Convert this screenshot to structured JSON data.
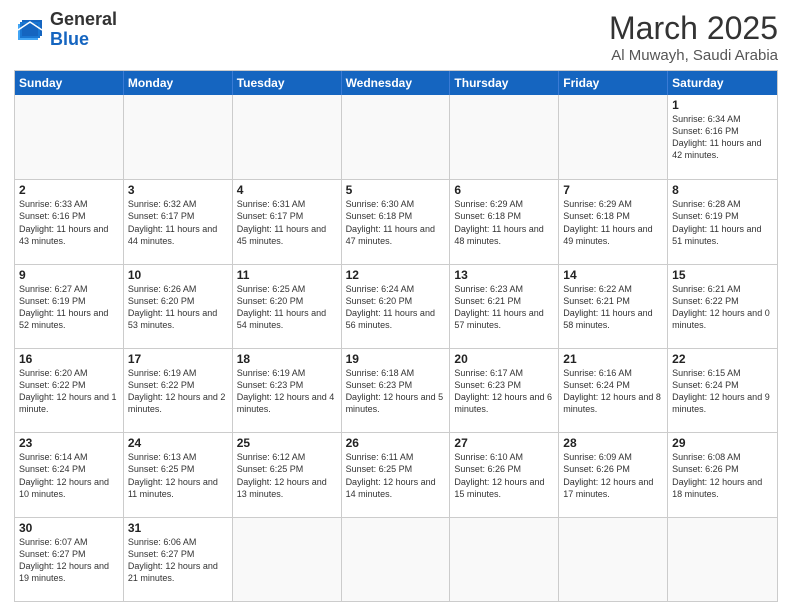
{
  "logo": {
    "text_general": "General",
    "text_blue": "Blue"
  },
  "header": {
    "month": "March 2025",
    "location": "Al Muwayh, Saudi Arabia"
  },
  "weekdays": [
    "Sunday",
    "Monday",
    "Tuesday",
    "Wednesday",
    "Thursday",
    "Friday",
    "Saturday"
  ],
  "weeks": [
    [
      {
        "day": "",
        "empty": true
      },
      {
        "day": "",
        "empty": true
      },
      {
        "day": "",
        "empty": true
      },
      {
        "day": "",
        "empty": true
      },
      {
        "day": "",
        "empty": true
      },
      {
        "day": "",
        "empty": true
      },
      {
        "day": "1",
        "sunrise": "6:34 AM",
        "sunset": "6:16 PM",
        "daylight": "11 hours and 42 minutes."
      }
    ],
    [
      {
        "day": "2",
        "sunrise": "6:33 AM",
        "sunset": "6:16 PM",
        "daylight": "11 hours and 43 minutes."
      },
      {
        "day": "3",
        "sunrise": "6:32 AM",
        "sunset": "6:17 PM",
        "daylight": "11 hours and 44 minutes."
      },
      {
        "day": "4",
        "sunrise": "6:31 AM",
        "sunset": "6:17 PM",
        "daylight": "11 hours and 45 minutes."
      },
      {
        "day": "5",
        "sunrise": "6:30 AM",
        "sunset": "6:18 PM",
        "daylight": "11 hours and 47 minutes."
      },
      {
        "day": "6",
        "sunrise": "6:29 AM",
        "sunset": "6:18 PM",
        "daylight": "11 hours and 48 minutes."
      },
      {
        "day": "7",
        "sunrise": "6:29 AM",
        "sunset": "6:18 PM",
        "daylight": "11 hours and 49 minutes."
      },
      {
        "day": "8",
        "sunrise": "6:28 AM",
        "sunset": "6:19 PM",
        "daylight": "11 hours and 51 minutes."
      }
    ],
    [
      {
        "day": "9",
        "sunrise": "6:27 AM",
        "sunset": "6:19 PM",
        "daylight": "11 hours and 52 minutes."
      },
      {
        "day": "10",
        "sunrise": "6:26 AM",
        "sunset": "6:20 PM",
        "daylight": "11 hours and 53 minutes."
      },
      {
        "day": "11",
        "sunrise": "6:25 AM",
        "sunset": "6:20 PM",
        "daylight": "11 hours and 54 minutes."
      },
      {
        "day": "12",
        "sunrise": "6:24 AM",
        "sunset": "6:20 PM",
        "daylight": "11 hours and 56 minutes."
      },
      {
        "day": "13",
        "sunrise": "6:23 AM",
        "sunset": "6:21 PM",
        "daylight": "11 hours and 57 minutes."
      },
      {
        "day": "14",
        "sunrise": "6:22 AM",
        "sunset": "6:21 PM",
        "daylight": "11 hours and 58 minutes."
      },
      {
        "day": "15",
        "sunrise": "6:21 AM",
        "sunset": "6:22 PM",
        "daylight": "12 hours and 0 minutes."
      }
    ],
    [
      {
        "day": "16",
        "sunrise": "6:20 AM",
        "sunset": "6:22 PM",
        "daylight": "12 hours and 1 minute."
      },
      {
        "day": "17",
        "sunrise": "6:19 AM",
        "sunset": "6:22 PM",
        "daylight": "12 hours and 2 minutes."
      },
      {
        "day": "18",
        "sunrise": "6:19 AM",
        "sunset": "6:23 PM",
        "daylight": "12 hours and 4 minutes."
      },
      {
        "day": "19",
        "sunrise": "6:18 AM",
        "sunset": "6:23 PM",
        "daylight": "12 hours and 5 minutes."
      },
      {
        "day": "20",
        "sunrise": "6:17 AM",
        "sunset": "6:23 PM",
        "daylight": "12 hours and 6 minutes."
      },
      {
        "day": "21",
        "sunrise": "6:16 AM",
        "sunset": "6:24 PM",
        "daylight": "12 hours and 8 minutes."
      },
      {
        "day": "22",
        "sunrise": "6:15 AM",
        "sunset": "6:24 PM",
        "daylight": "12 hours and 9 minutes."
      }
    ],
    [
      {
        "day": "23",
        "sunrise": "6:14 AM",
        "sunset": "6:24 PM",
        "daylight": "12 hours and 10 minutes."
      },
      {
        "day": "24",
        "sunrise": "6:13 AM",
        "sunset": "6:25 PM",
        "daylight": "12 hours and 11 minutes."
      },
      {
        "day": "25",
        "sunrise": "6:12 AM",
        "sunset": "6:25 PM",
        "daylight": "12 hours and 13 minutes."
      },
      {
        "day": "26",
        "sunrise": "6:11 AM",
        "sunset": "6:25 PM",
        "daylight": "12 hours and 14 minutes."
      },
      {
        "day": "27",
        "sunrise": "6:10 AM",
        "sunset": "6:26 PM",
        "daylight": "12 hours and 15 minutes."
      },
      {
        "day": "28",
        "sunrise": "6:09 AM",
        "sunset": "6:26 PM",
        "daylight": "12 hours and 17 minutes."
      },
      {
        "day": "29",
        "sunrise": "6:08 AM",
        "sunset": "6:26 PM",
        "daylight": "12 hours and 18 minutes."
      }
    ],
    [
      {
        "day": "30",
        "sunrise": "6:07 AM",
        "sunset": "6:27 PM",
        "daylight": "12 hours and 19 minutes."
      },
      {
        "day": "31",
        "sunrise": "6:06 AM",
        "sunset": "6:27 PM",
        "daylight": "12 hours and 21 minutes."
      },
      {
        "day": "",
        "empty": true
      },
      {
        "day": "",
        "empty": true
      },
      {
        "day": "",
        "empty": true
      },
      {
        "day": "",
        "empty": true
      },
      {
        "day": "",
        "empty": true
      }
    ]
  ]
}
